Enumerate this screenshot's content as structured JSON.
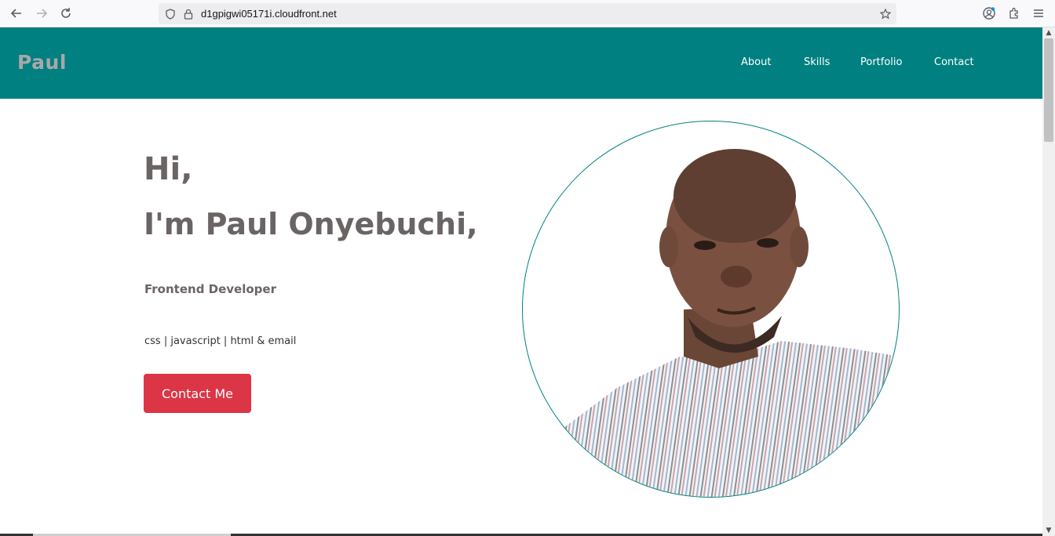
{
  "browser": {
    "url": "d1gpigwi05171i.cloudfront.net",
    "back_icon": "arrow-left-icon",
    "forward_icon": "arrow-right-icon",
    "reload_icon": "reload-icon"
  },
  "header": {
    "logo": "Paul",
    "nav": [
      {
        "label": "About"
      },
      {
        "label": "Skills"
      },
      {
        "label": "Portfolio"
      },
      {
        "label": "Contact"
      }
    ],
    "background_color": "#008080"
  },
  "hero": {
    "greeting": "Hi,",
    "name_line": "I'm Paul Onyebuchi,",
    "role": "Frontend Developer",
    "skills": "css | javascript | html & email",
    "cta_label": "Contact Me",
    "cta_color": "#dc3545"
  }
}
